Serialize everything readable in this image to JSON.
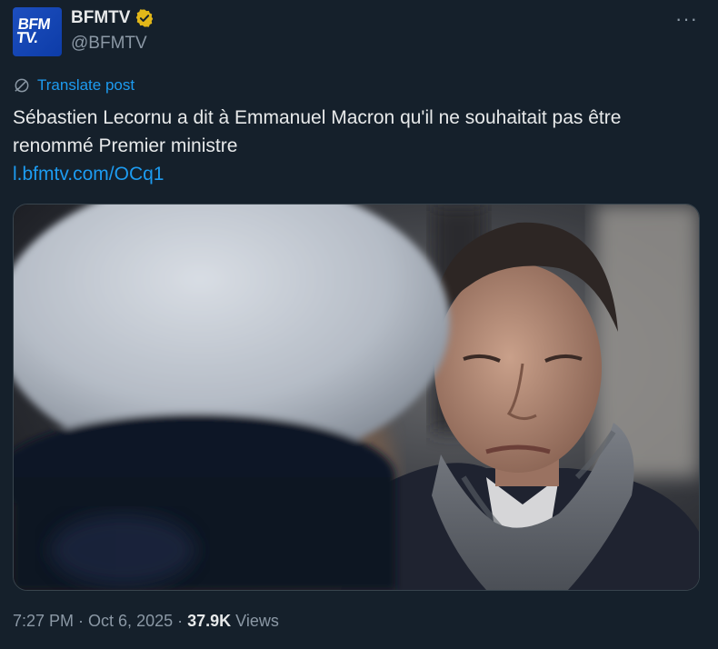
{
  "author": {
    "display_name": "BFMTV",
    "handle": "@BFMTV",
    "avatar_text_line1": "BFM",
    "avatar_text_line2": "TV.",
    "verified_color": "#e2b719"
  },
  "post": {
    "translate_label": "Translate post",
    "text": "Sébastien Lecornu a dit à Emmanuel Macron qu'il ne souhaitait pas être renommé Premier ministre",
    "link": "l.bfmtv.com/OCq1"
  },
  "meta": {
    "time": "7:27 PM",
    "separator": "·",
    "date": "Oct 6, 2025",
    "views_count": "37.9K",
    "views_label": "Views"
  },
  "menu": {
    "more_label": "···"
  },
  "colors": {
    "background": "#15202b",
    "link": "#1d9bf0",
    "secondary_text": "#8b98a5",
    "primary_text": "#e7e9ea"
  }
}
